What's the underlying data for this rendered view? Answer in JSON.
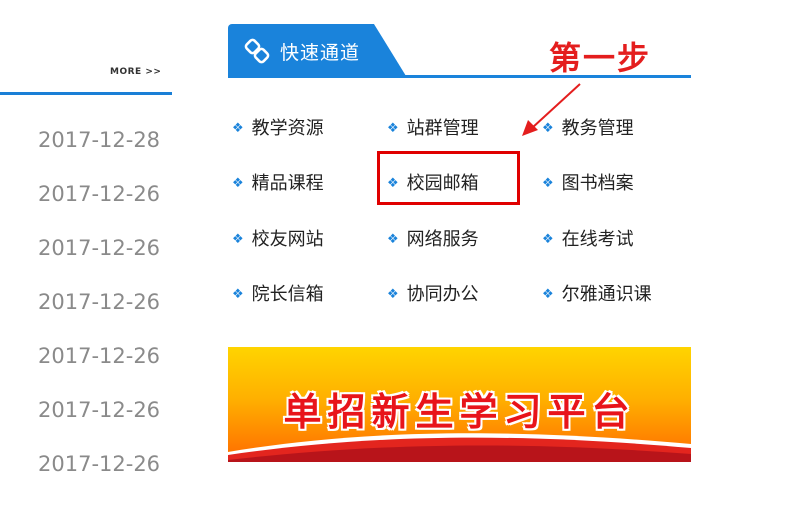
{
  "left_column": {
    "more_label": "MORE >>",
    "dates": [
      "2017-12-28",
      "2017-12-26",
      "2017-12-26",
      "2017-12-26",
      "2017-12-26",
      "2017-12-26",
      "2017-12-26"
    ]
  },
  "panel": {
    "tab_title": "快速通道",
    "tab_icon": "link-icon",
    "step_label": "第一步",
    "links": [
      {
        "label": "教学资源"
      },
      {
        "label": "站群管理"
      },
      {
        "label": "教务管理"
      },
      {
        "label": "精品课程"
      },
      {
        "label": "校园邮箱"
      },
      {
        "label": "图书档案"
      },
      {
        "label": "校友网站"
      },
      {
        "label": "网络服务"
      },
      {
        "label": "在线考试"
      },
      {
        "label": "院长信箱"
      },
      {
        "label": "协同办公"
      },
      {
        "label": "尔雅通识课"
      }
    ],
    "bullet_symbol": "❖"
  },
  "banner": {
    "text": "单招新生学习平台"
  },
  "colors": {
    "accent_blue": "#1a83db",
    "annotation_red": "#e41e1e",
    "date_gray": "#8a8a8a"
  }
}
